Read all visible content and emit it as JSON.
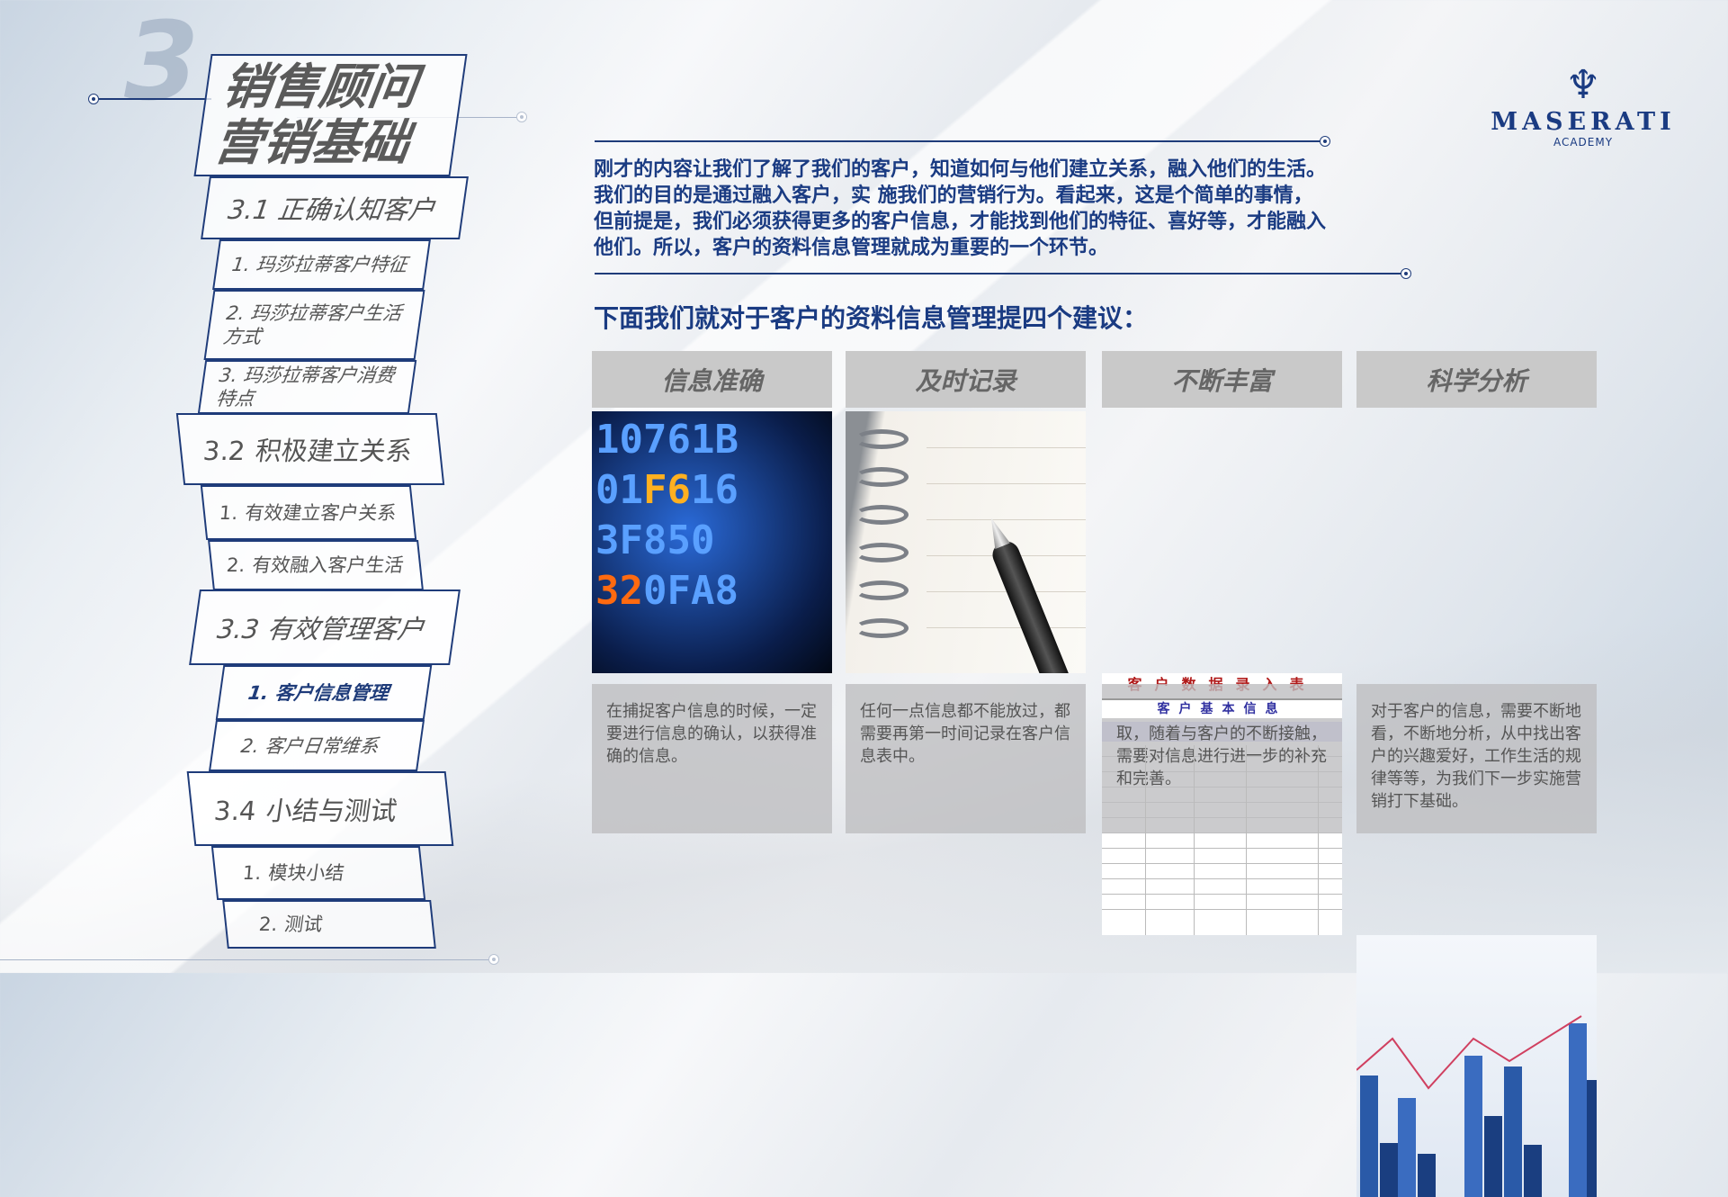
{
  "sidebar": {
    "chapter_number": "3",
    "title_line1": "销售顾问",
    "title_line2": "营销基础",
    "sections": [
      {
        "label": "3.1 正确认知客户",
        "items": [
          "1. 玛莎拉蒂客户特征",
          "2. 玛莎拉蒂客户生活方式",
          "3. 玛莎拉蒂客户消费特点"
        ]
      },
      {
        "label": "3.2 积极建立关系",
        "items": [
          "1. 有效建立客户关系",
          "2. 有效融入客户生活"
        ]
      },
      {
        "label": "3.3 有效管理客户",
        "items": [
          "1. 客户信息管理",
          "2. 客户日常维系"
        ]
      },
      {
        "label": "3.4 小结与测试",
        "items": [
          "1. 模块小结",
          "2. 测试"
        ]
      }
    ],
    "active_item": "1. 客户信息管理"
  },
  "logo": {
    "brand": "MASERATI",
    "subtitle": "ACADEMY",
    "icon": "trident-icon"
  },
  "main": {
    "intro": "刚才的内容让我们了解了我们的客户，知道如何与他们建立关系，融入他们的生活。我们的目的是通过融入客户，实 施我们的营销行为。看起来，这是个简单的事情，但前提是，我们必须获得更多的客户信息，才能找到他们的特征、喜好等，才能融入他们。所以，客户的资料信息管理就成为重要的一个环节。",
    "heading": "下面我们就对于客户的资料信息管理提四个建议：",
    "cards": [
      {
        "title": "信息准确",
        "description": "在捕捉客户信息的时候，一定要进行信息的确认，以获得准确的信息。"
      },
      {
        "title": "及时记录",
        "description": "任何一点信息都不能放过，都需要再第一时间记录在客户信息表中。"
      },
      {
        "title": "不断丰富",
        "description": "客户的信息不可能一次全部获取，随着与客户的不断接触，需要对信息进行进一步的补充和完善。"
      },
      {
        "title": "科学分析",
        "description": "对于客户的信息，需要不断地看，不断地分析，从中找出客户的兴趣爱好，工作生活的规律等等，为我们下一步实施营销打下基础。"
      }
    ],
    "sheet_image": {
      "title": "客户数据录入表",
      "subtitle": "客户基本信息"
    }
  },
  "colors": {
    "accent": "#1f3c7a",
    "text_blue": "#1a3b82",
    "card_header": "#c9c9c9"
  }
}
